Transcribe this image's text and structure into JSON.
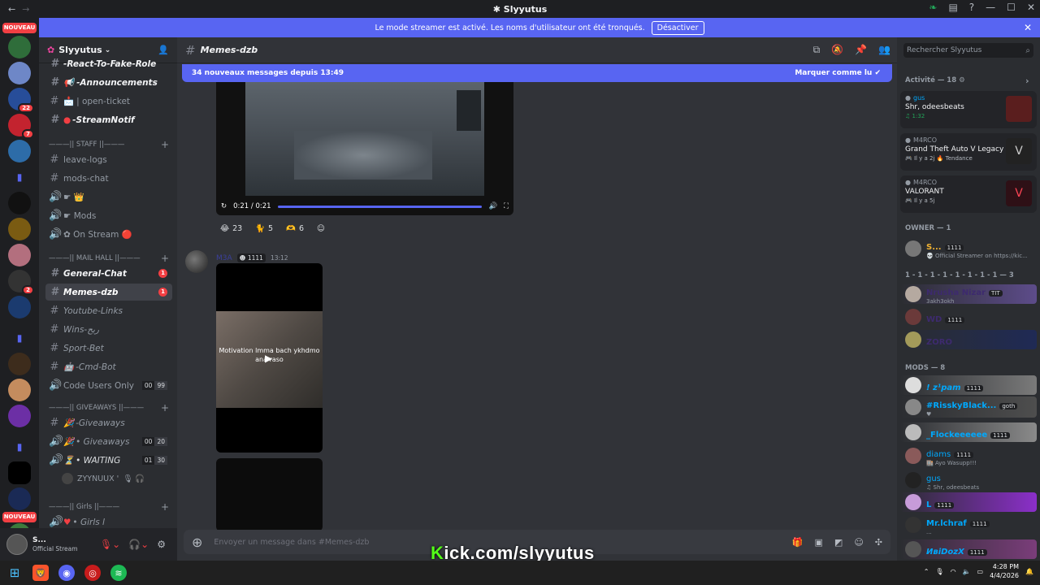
{
  "window": {
    "title": "Slyyutus"
  },
  "banner": {
    "text": "Le mode streamer est activé. Les noms d'utilisateur ont été tronqués.",
    "button": "Désactiver"
  },
  "guilds": {
    "new_label_top": "NOUVEAU",
    "new_label_bottom": "NOUVEAU",
    "badge_22": "22",
    "badge_7": "7",
    "badge_2": "2"
  },
  "server": {
    "name": "Slyyutus"
  },
  "channels": {
    "roleplay": "-React-To-Fake-Role",
    "announcements": "-Announcements",
    "open_ticket": "| open-ticket",
    "streamnotif": "-StreamNotif",
    "cat_staff": "———|| STAFF ||———",
    "leave_logs": "leave-logs",
    "mods_chat": "mods-chat",
    "voice_crown": "☛ 👑",
    "mods": "☛ Mods",
    "on_stream": "✿ On Stream 🔴",
    "cat_mail": "———|| MAIL HALL ||———",
    "general_chat": "General-Chat",
    "general_badge": "1",
    "memes": "Memes-dzb",
    "memes_badge": "1",
    "youtube_links": "Youtube-Links",
    "wins": "Wins-ربح",
    "sport_bet": "Sport-Bet",
    "cmd_bot": "-Cmd-Bot",
    "code_users": "Code Users Only",
    "code_users_cnt": [
      "00",
      "99"
    ],
    "cat_giveaways": "———|| GIVEAWAYS ||———",
    "giveaways_text": "-Giveaways",
    "giveaways_voice": "• Giveaways",
    "giveaways_cnt": [
      "00",
      "20"
    ],
    "waiting": "• WAITING",
    "waiting_cnt": [
      "01",
      "30"
    ],
    "voice_user": "ZYYNUUX '",
    "cat_girls": "———|| Girls ||———",
    "girls": "• Girls l"
  },
  "user_panel": {
    "name": "S...",
    "status": "Official Stream"
  },
  "chat": {
    "channel_name": "Memes-dzb",
    "new_messages": "34 nouveaux messages depuis 13:49",
    "mark_read": "Marquer comme lu",
    "video1_time": "0:21 / 0:21",
    "reactions": [
      {
        "emoji": "😂",
        "count": "23"
      },
      {
        "emoji": "🐈",
        "count": "5"
      },
      {
        "emoji": "🫶",
        "count": "6"
      }
    ],
    "msg2_name": "M3A",
    "msg2_tag": "1111",
    "msg2_time": "13:12",
    "video2_caption": "Motivation lmma bach ykhdmo ana raso",
    "composer_placeholder": "Envoyer un message dans #Memes-dzb"
  },
  "overlay": {
    "kick_k": "K",
    "kick_rest": "ick.com/slyyutus"
  },
  "members": {
    "search_placeholder": "Rechercher Slyyutus",
    "activity_header": "Activité — 18",
    "activities": [
      {
        "user": "gus",
        "title": "Shr, odeesbeats",
        "meta": "♫ 1:32"
      },
      {
        "user": "M4RCO",
        "title": "Grand Theft Auto V Legacy",
        "meta": "🎮 Il y a 2j  🔥 Tendance"
      },
      {
        "user": "M4RCO",
        "title": "VALORANT",
        "meta": "🎮 Il y a 5j"
      }
    ],
    "owner_header": "OWNER — 1",
    "owner": {
      "name": "S...",
      "tag": "1111",
      "sub": "💀 Official Streamer on https://kic..."
    },
    "group_header": "1 - 1 - 1 - 1 - 1 - 1 - 1 - 1 — 3",
    "group": [
      {
        "name": "Nrusha Nizar",
        "tag": "TIT",
        "sub": "3akh3okh"
      },
      {
        "name": "WD",
        "tag": "1111",
        "sub": ""
      },
      {
        "name": "ZORO",
        "tag": "",
        "sub": ""
      }
    ],
    "mods_header": "MODS — 8",
    "mods": [
      {
        "name": "! z¹pam",
        "tag": "1111",
        "sub": ""
      },
      {
        "name": "#RisskyBlack...",
        "tag": "goth",
        "sub": "♥"
      },
      {
        "name": "_Flockeeeeee",
        "tag": "1111",
        "sub": ""
      },
      {
        "name": "diams",
        "tag": "1111",
        "sub": "🏬 Ayo Wasupp!!!"
      },
      {
        "name": "gus",
        "tag": "",
        "sub": "♫ Shr, odeesbeats"
      },
      {
        "name": "L",
        "tag": "1111",
        "sub": ""
      },
      {
        "name": "Mr.lchraf",
        "tag": "1111",
        "sub": "..."
      },
      {
        "name": "ИвіDozX",
        "tag": "1111",
        "sub": ""
      }
    ]
  },
  "taskbar": {
    "time": "4:28 PM",
    "date": "4/4/2026"
  }
}
